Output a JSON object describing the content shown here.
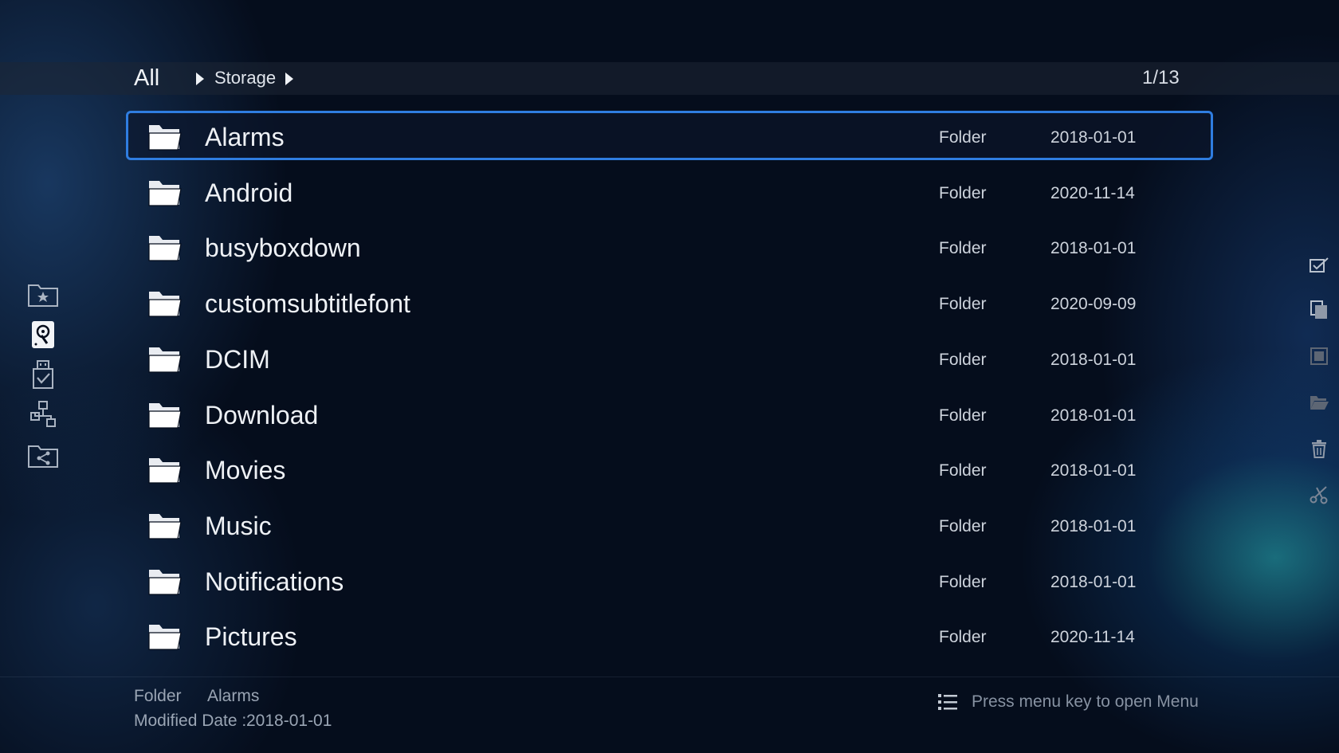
{
  "breadcrumb": {
    "root": "All",
    "current": "Storage"
  },
  "page_indicator": "1/13",
  "sidebar": {
    "items": [
      {
        "icon": "favorite-folder-icon"
      },
      {
        "icon": "local-storage-icon",
        "active": true
      },
      {
        "icon": "usb-storage-icon"
      },
      {
        "icon": "network-icon"
      },
      {
        "icon": "share-folder-icon"
      }
    ]
  },
  "files": [
    {
      "name": "Alarms",
      "type": "Folder",
      "date": "2018-01-01",
      "selected": true
    },
    {
      "name": "Android",
      "type": "Folder",
      "date": "2020-11-14"
    },
    {
      "name": "busyboxdown",
      "type": "Folder",
      "date": "2018-01-01"
    },
    {
      "name": "customsubtitlefont",
      "type": "Folder",
      "date": "2020-09-09"
    },
    {
      "name": "DCIM",
      "type": "Folder",
      "date": "2018-01-01"
    },
    {
      "name": "Download",
      "type": "Folder",
      "date": "2018-01-01"
    },
    {
      "name": "Movies",
      "type": "Folder",
      "date": "2018-01-01"
    },
    {
      "name": "Music",
      "type": "Folder",
      "date": "2018-01-01"
    },
    {
      "name": "Notifications",
      "type": "Folder",
      "date": "2018-01-01"
    },
    {
      "name": "Pictures",
      "type": "Folder",
      "date": "2020-11-14"
    }
  ],
  "right_tools": [
    {
      "icon": "select-checkbox-icon"
    },
    {
      "icon": "copy-icon"
    },
    {
      "icon": "select-all-icon"
    },
    {
      "icon": "open-folder-icon"
    },
    {
      "icon": "trash-icon"
    },
    {
      "icon": "cut-scissors-icon"
    }
  ],
  "footer": {
    "info_type": "Folder",
    "info_name": "Alarms",
    "modified_label": "Modified Date :",
    "modified_value": "2018-01-01",
    "menu_hint": "Press menu key to open Menu"
  },
  "colors": {
    "accent": "#2f7de0",
    "background": "#050d1c"
  }
}
